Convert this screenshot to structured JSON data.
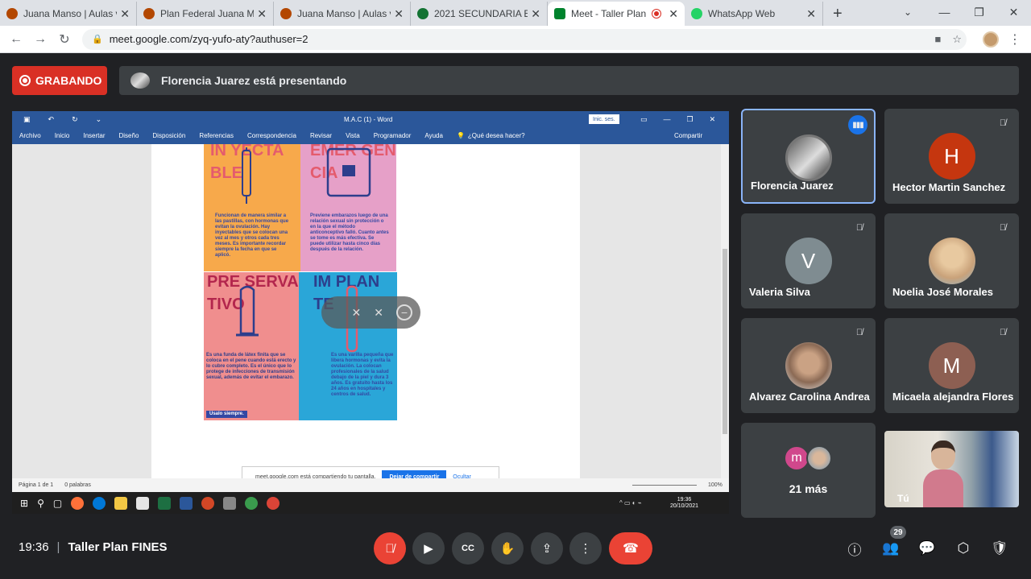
{
  "browser": {
    "tabs": [
      {
        "title": "Juana Manso | Aulas v",
        "favicon_color": "#b34700",
        "active": false
      },
      {
        "title": "Plan Federal Juana Ma",
        "favicon_color": "#b34700",
        "active": false
      },
      {
        "title": "Juana Manso | Aulas v",
        "favicon_color": "#b34700",
        "active": false
      },
      {
        "title": "2021 SECUNDARIA EA",
        "favicon_color": "#137333",
        "active": false
      },
      {
        "title": "Meet - Taller Plan",
        "favicon_color": "#00832d",
        "active": true
      },
      {
        "title": "WhatsApp Web",
        "favicon_color": "#25d366",
        "active": false
      }
    ],
    "new_tab": "+",
    "url": "meet.google.com/zyq-yufo-aty?authuser=2"
  },
  "meet": {
    "recording_label": "GRABANDO",
    "presenting_label": "Florencia Juarez está presentando",
    "participants": [
      {
        "name": "Florencia Juarez",
        "initial": "",
        "avatar_color": "#6b6b6b",
        "speaking": true
      },
      {
        "name": "Hector Martin Sanchez",
        "initial": "H",
        "avatar_color": "#c5360f",
        "speaking": false
      },
      {
        "name": "Valeria Silva",
        "initial": "V",
        "avatar_color": "#7f8c91",
        "speaking": false
      },
      {
        "name": "Noelia José Morales",
        "initial": "",
        "avatar_color": "#c9a27a",
        "speaking": false
      },
      {
        "name": "Alvarez Carolina Andrea",
        "initial": "",
        "avatar_color": "#8b6a55",
        "speaking": false
      },
      {
        "name": "Micaela alejandra Flores",
        "initial": "M",
        "avatar_color": "#8d5f52",
        "speaking": false
      }
    ],
    "more": {
      "label": "21 más",
      "initial": "m"
    },
    "self_label": "Tú",
    "time": "19:36",
    "meeting_title": "Taller Plan FINES",
    "people_count": "29"
  },
  "shared_screen": {
    "word_title": "M.A.C (1) - Word",
    "sign_in": "Inic. ses.",
    "ribbon": [
      "Archivo",
      "Inicio",
      "Insertar",
      "Diseño",
      "Disposición",
      "Referencias",
      "Correspondencia",
      "Revisar",
      "Vista",
      "Programador",
      "Ayuda",
      "¿Qué desea hacer?"
    ],
    "share_btn": "Compartir",
    "cards": [
      {
        "heading": "IN YECTA BLE",
        "text": "Funcionan de manera similar a las pastillas, con hormonas que evitan la ovulación. Hay inyectables que se colocan una vez al mes y otros cada tres meses. Es importante recordar siempre la fecha en que se aplicó."
      },
      {
        "heading": "EMER GEN CIA",
        "text": "Previene embarazos luego de una relación sexual sin protección o en la que el método anticonceptivo falló. Cuanto antes se tome es más efectiva. Se puede utilizar hasta cinco días después de la relación."
      },
      {
        "heading": "PRE SERVA TIVO",
        "text": "Es una funda de látex finita que se coloca en el pene cuando está erecto y lo cubre completo. Es el único que lo protege de infecciones de transmisión sexual, además de evitar el embarazo.",
        "tag": "Usalo siempre."
      },
      {
        "heading": "IM PLAN TE",
        "text": "Es una varilla pequeña que libera hormonas y evita la ovulación. La colocan profesionales de la salud debajo de la piel y dura 3 años. Es gratuito hasta los 24 años en hospitales y centros de salud."
      }
    ],
    "share_notice": "meet.google.com está compartiendo tu pantalla.",
    "stop_share": "Dejar de compartir",
    "hide": "Ocultar",
    "status_page": "Página 1 de 1",
    "status_words": "0 palabras",
    "zoom": "100%",
    "clock_time": "19:36",
    "clock_date": "20/10/2021"
  }
}
